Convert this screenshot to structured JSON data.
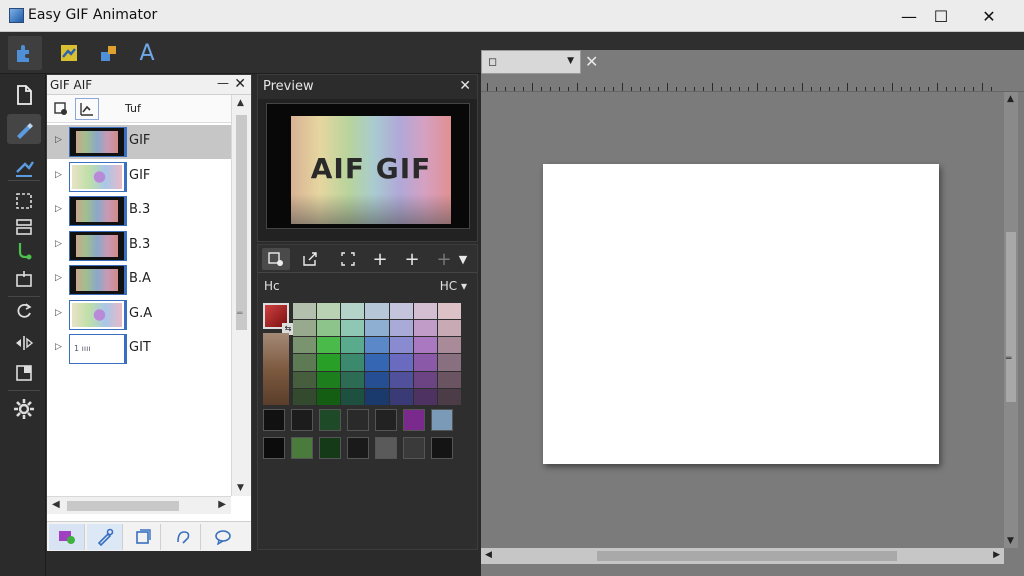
{
  "window": {
    "title": "Easy GIF Animator",
    "minimize_label": "—",
    "maximize_label": "☐",
    "close_label": "✕"
  },
  "toolbar": {
    "items": [
      "puzzle-icon",
      "image-edit-icon",
      "shapes-icon",
      "text-tool-icon"
    ],
    "text_tool_label": "A"
  },
  "sidetools": {
    "items": [
      "new-file-icon",
      "brush-icon",
      "line-icon",
      "select-icon",
      "layers-icon",
      "eyedropper-icon",
      "crop-icon",
      "rotate-icon",
      "flip-icon",
      "resize-icon",
      "settings-icon"
    ]
  },
  "frames_panel": {
    "title": "GIF AIF",
    "pin_label": "—",
    "close_label": "✕",
    "tool_label": "Tuf",
    "frames": [
      {
        "label": "GIF",
        "thumb": "dark",
        "selected": true
      },
      {
        "label": "GIF",
        "thumb": "flower",
        "selected": false
      },
      {
        "label": "B.3",
        "thumb": "dark",
        "selected": false
      },
      {
        "label": "B.3",
        "thumb": "dark",
        "selected": false
      },
      {
        "label": "B.A",
        "thumb": "dark",
        "selected": false
      },
      {
        "label": "G.A",
        "thumb": "flower",
        "selected": false
      },
      {
        "label": "GIT",
        "thumb": "text",
        "selected": false,
        "thumb_text": "1 ıııı"
      }
    ],
    "bottom_tools": [
      "layer-color-icon",
      "pen-icon",
      "duplicate-icon",
      "effects-icon",
      "speech-icon"
    ]
  },
  "preview": {
    "title": "Preview",
    "close_label": "✕",
    "image_text": "AIF GIF"
  },
  "color_panel": {
    "tools": [
      "add-frame-icon",
      "export-icon",
      "frame-select-icon",
      "plus-icon",
      "plus-icon",
      "plus-icon",
      "chevron-down-icon"
    ],
    "header_left": "Hc",
    "header_right": "HC",
    "dropdown_label": "▾",
    "fg_color": "#c02828",
    "palette": [
      [
        "#b4c0ae",
        "#b9d2b3",
        "#b5d4c9",
        "#b6c8d8",
        "#c4c4dc",
        "#d4bfd2",
        "#dcc2c6"
      ],
      [
        "#98aa8e",
        "#8cc48c",
        "#8ec8b4",
        "#8eaed2",
        "#aaaad8",
        "#c29cc8",
        "#c8aab4"
      ],
      [
        "#7a9470",
        "#4aba4a",
        "#5aaa8e",
        "#5a88c8",
        "#8a8ad0",
        "#aa78c0",
        "#a88a98"
      ],
      [
        "#5e7a54",
        "#28a028",
        "#3c8a6e",
        "#3466b4",
        "#6a6ac0",
        "#8a5aa8",
        "#887080"
      ],
      [
        "#465e3e",
        "#1c7e1c",
        "#2c6c54",
        "#264e92",
        "#50509c",
        "#6c4484",
        "#6a5462"
      ],
      [
        "#344a2e",
        "#145e14",
        "#1e5040",
        "#1a3a6e",
        "#3a3a76",
        "#4e3262",
        "#4c3c48"
      ]
    ],
    "swatch_row_1": [
      "#111111",
      "#1c1c1c",
      "#1e4a28",
      "#2a2a2a",
      "#222222",
      "#7a2a8c",
      "#7a9ab8"
    ],
    "swatch_row_2": [
      "#0c0c0c",
      "#4a7a3c",
      "#143a18",
      "#1a1a1a",
      "#5a5a5a",
      "#3a3a3a",
      "#141414"
    ]
  },
  "canvas": {
    "tab_icon": "document-icon",
    "close_label": "✕"
  }
}
